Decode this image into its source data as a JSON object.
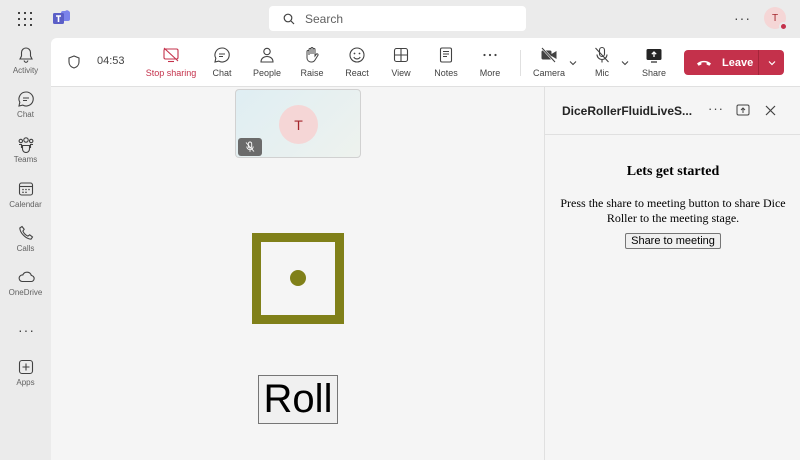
{
  "search": {
    "placeholder": "Search"
  },
  "user": {
    "initial": "T"
  },
  "rail": {
    "items": [
      {
        "label": "Activity",
        "icon": "bell-icon"
      },
      {
        "label": "Chat",
        "icon": "chat-icon"
      },
      {
        "label": "Teams",
        "icon": "teams-icon"
      },
      {
        "label": "Calendar",
        "icon": "calendar-icon"
      },
      {
        "label": "Calls",
        "icon": "phone-icon"
      },
      {
        "label": "OneDrive",
        "icon": "cloud-icon"
      },
      {
        "label": "Apps",
        "icon": "add-app-icon"
      }
    ]
  },
  "toolbar": {
    "timer": "04:53",
    "stop_sharing": "Stop sharing",
    "chat": "Chat",
    "people": "People",
    "raise": "Raise",
    "react": "React",
    "view": "View",
    "notes": "Notes",
    "more": "More",
    "camera": "Camera",
    "mic": "Mic",
    "share": "Share",
    "leave": "Leave"
  },
  "stage": {
    "participant_initial": "T",
    "roll_label": "Roll",
    "die_value": 1
  },
  "panel": {
    "title": "DiceRollerFluidLiveS...",
    "heading": "Lets get started",
    "description": "Press the share to meeting button to share Dice Roller to the meeting stage.",
    "button": "Share to meeting"
  },
  "colors": {
    "accent": "#c4314b",
    "die": "#808019",
    "teams_brand": "#5b5fc7"
  }
}
